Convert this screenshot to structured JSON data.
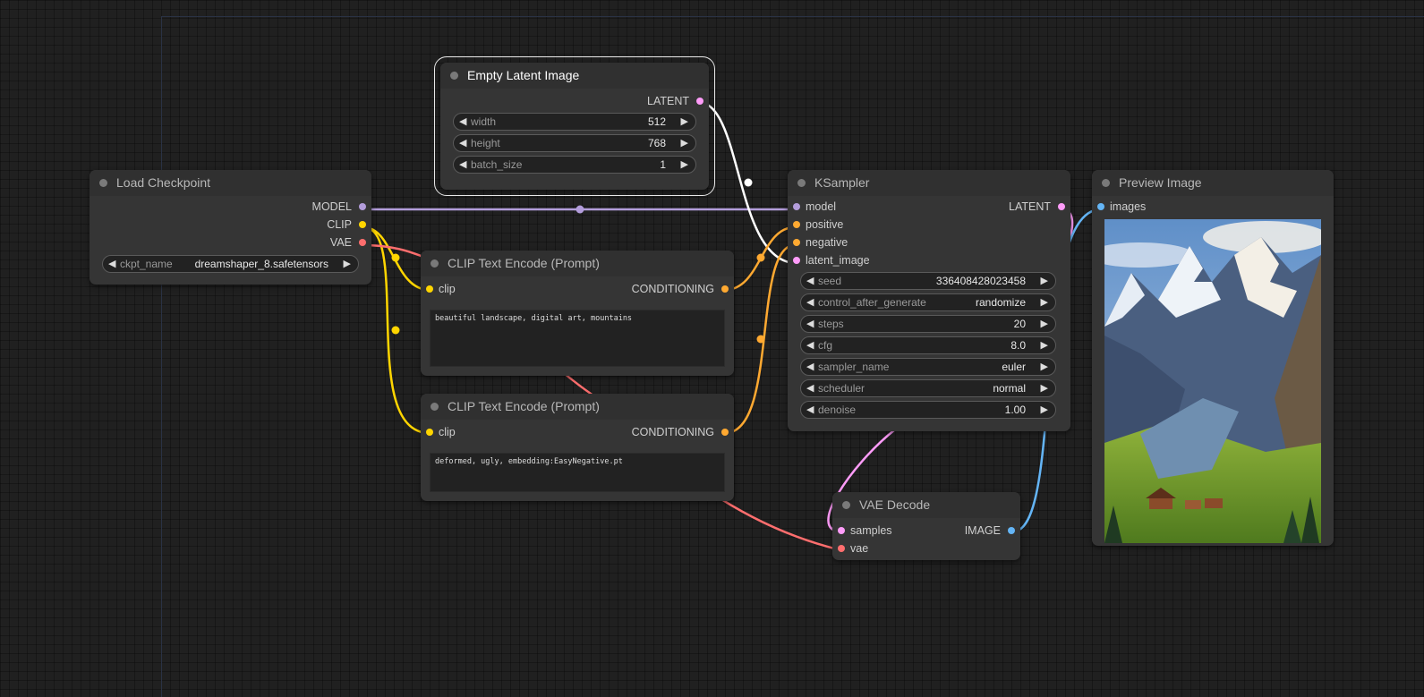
{
  "colors": {
    "model": "#b39ddb",
    "clip": "#ffd500",
    "vae": "#ff6e6e",
    "latent": "#ff9cf9",
    "conditioning": "#ffa931",
    "image": "#64b5f6",
    "latent_link": "#ffffff"
  },
  "nodes": {
    "empty_latent": {
      "title": "Empty Latent Image",
      "output": "LATENT",
      "widgets": [
        {
          "label": "width",
          "value": "512"
        },
        {
          "label": "height",
          "value": "768"
        },
        {
          "label": "batch_size",
          "value": "1"
        }
      ]
    },
    "load_checkpoint": {
      "title": "Load Checkpoint",
      "outputs": [
        "MODEL",
        "CLIP",
        "VAE"
      ],
      "widget": {
        "label": "ckpt_name",
        "value": "dreamshaper_8.safetensors"
      }
    },
    "clip_pos": {
      "title": "CLIP Text Encode (Prompt)",
      "input": "clip",
      "output": "CONDITIONING",
      "text": "beautiful landscape, digital art, mountains"
    },
    "clip_neg": {
      "title": "CLIP Text Encode (Prompt)",
      "input": "clip",
      "output": "CONDITIONING",
      "text": "deformed, ugly, embedding:EasyNegative.pt"
    },
    "ksampler": {
      "title": "KSampler",
      "inputs": [
        "model",
        "positive",
        "negative",
        "latent_image"
      ],
      "output": "LATENT",
      "widgets": [
        {
          "label": "seed",
          "value": "336408428023458"
        },
        {
          "label": "control_after_generate",
          "value": "randomize"
        },
        {
          "label": "steps",
          "value": "20"
        },
        {
          "label": "cfg",
          "value": "8.0"
        },
        {
          "label": "sampler_name",
          "value": "euler"
        },
        {
          "label": "scheduler",
          "value": "normal"
        },
        {
          "label": "denoise",
          "value": "1.00"
        }
      ]
    },
    "vae_decode": {
      "title": "VAE Decode",
      "inputs": [
        "samples",
        "vae"
      ],
      "output": "IMAGE"
    },
    "preview": {
      "title": "Preview Image",
      "input": "images"
    }
  }
}
